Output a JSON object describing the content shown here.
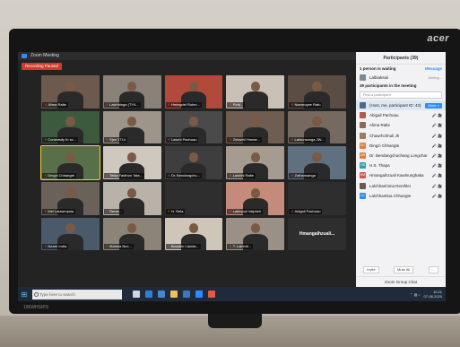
{
  "window": {
    "title": "Zoom Meeting",
    "recording_label": "Recording Paused"
  },
  "monitor": {
    "brand": "acer",
    "model": "195WHSIPS"
  },
  "gallery": {
    "tiles": [
      {
        "name": "Alima Ralte",
        "video": true,
        "bg": "#6c5a4e"
      },
      {
        "name": "Lalchhinga (TY4...",
        "video": true,
        "bg": "#8a8178"
      },
      {
        "name": "Hmingdel Rohm...",
        "video": true,
        "bg": "#b24a3c"
      },
      {
        "name": "Rohj...",
        "video": true,
        "bg": "#c9c1b6"
      },
      {
        "name": "Nanmoyee Rafu",
        "video": true,
        "bg": "#5b4c44"
      },
      {
        "name": "Conextsity Ib sc...",
        "video": true,
        "bg": "#3c5a3e"
      },
      {
        "name": "Sjes 1714",
        "video": true,
        "bg": "#9e958a"
      },
      {
        "name": "Lawmi Pachuau",
        "video": true,
        "bg": "#4a4a4a"
      },
      {
        "name": "Zirtawhi Hnmar...",
        "video": true,
        "bg": "#6f5d52"
      },
      {
        "name": "Lalnunsanga JW...",
        "video": true,
        "bg": "#766a60"
      },
      {
        "name": "Dingzi Chhangte",
        "video": true,
        "bg": "#58704a",
        "active": true
      },
      {
        "name": "Tekla Faldhon Tata...",
        "video": true,
        "bg": "#cfc8be"
      },
      {
        "name": "Dr. Bendangchu...",
        "video": true,
        "bg": "#3e3e3e"
      },
      {
        "name": "Lalchhi Ralte",
        "video": true,
        "bg": "#a69b8f"
      },
      {
        "name": "Zothansanga",
        "video": true,
        "bg": "#5f7080"
      },
      {
        "name": "Mel Lalawmpuia",
        "video": true,
        "bg": "#6a6258"
      },
      {
        "name": "Renzl...",
        "video": true,
        "bg": "#b9b2a8"
      },
      {
        "name": "H. Rela",
        "video": false,
        "bg": "#2e2e2e"
      },
      {
        "name": "Lalrinpuii Vaipheil",
        "video": true,
        "bg": "#c48a7a"
      },
      {
        "name": "Abigail Pachuau",
        "video": false,
        "bg": "#2e2e2e"
      },
      {
        "name": "Nearn India",
        "video": true,
        "bg": "#4b5a6a"
      },
      {
        "name": "Mahela Boo...",
        "video": true,
        "bg": "#8c8478"
      },
      {
        "name": "Brosalin Lianda...",
        "video": true,
        "bg": "#cfc6ba"
      },
      {
        "name": "T. Lalrinhi...",
        "video": true,
        "bg": "#9a9085"
      },
      {
        "name": "Hmangaihzuali...",
        "video": false,
        "bg": "#2e2e2e",
        "center": true
      }
    ]
  },
  "panel": {
    "title": "Participants (39)",
    "waiting_header": "1 person is waiting",
    "waiting_action": "Message",
    "waiting": {
      "name": "Lalbiaksaii",
      "status": "Joining..."
    },
    "in_meeting_header": "39 participants in the meeting",
    "find_placeholder": "Find a participant",
    "participants": [
      {
        "name": "(Host, me, participant ID: 43)",
        "color": "#4a6b8a",
        "selected": true,
        "button": "More >"
      },
      {
        "name": "Abigail Pachuau",
        "color": "#b35a48"
      },
      {
        "name": "Alima Ralte",
        "color": "#8a6a55"
      },
      {
        "name": "Chawrhchhuli Jh",
        "color": "#9a7a60"
      },
      {
        "name": "Dingzi Chhangte",
        "color": "#e07b39",
        "initials": "DC"
      },
      {
        "name": "Dr. Bendangchuchang Longchar",
        "color": "#e07b39",
        "initials": "DR"
      },
      {
        "name": "H.S. Thapa",
        "color": "#2aa1b3",
        "initials": "HS"
      },
      {
        "name": "Hmangaihzuali Kawlnunghaka",
        "color": "#d9534f",
        "initials": "HM"
      },
      {
        "name": "Lalchhanhima Renthlei",
        "color": "#6b5a4e"
      },
      {
        "name": "Lalchhantlua Chhangte",
        "color": "#2d8cff",
        "initials": "LC"
      }
    ],
    "mute_icons": "🎤 🎥",
    "footer_invite": "Invite",
    "footer_mute": "Mute All",
    "footer_more": "...",
    "group_chat": "Zoom Group Chat"
  },
  "taskbar": {
    "search_placeholder": "Type here to search",
    "time": "10:21",
    "date": "07-08-2020",
    "apps": [
      {
        "name": "task-view-icon",
        "color": "#cfd6e0"
      },
      {
        "name": "edge-icon",
        "color": "#2f7fd6"
      },
      {
        "name": "store-icon",
        "color": "#4b86c9"
      },
      {
        "name": "folder-icon",
        "color": "#e8c25a"
      },
      {
        "name": "mail-icon",
        "color": "#3a77c4"
      },
      {
        "name": "zoom-icon",
        "color": "#2d8cff"
      },
      {
        "name": "chrome-icon",
        "color": "#e25a44"
      }
    ]
  }
}
